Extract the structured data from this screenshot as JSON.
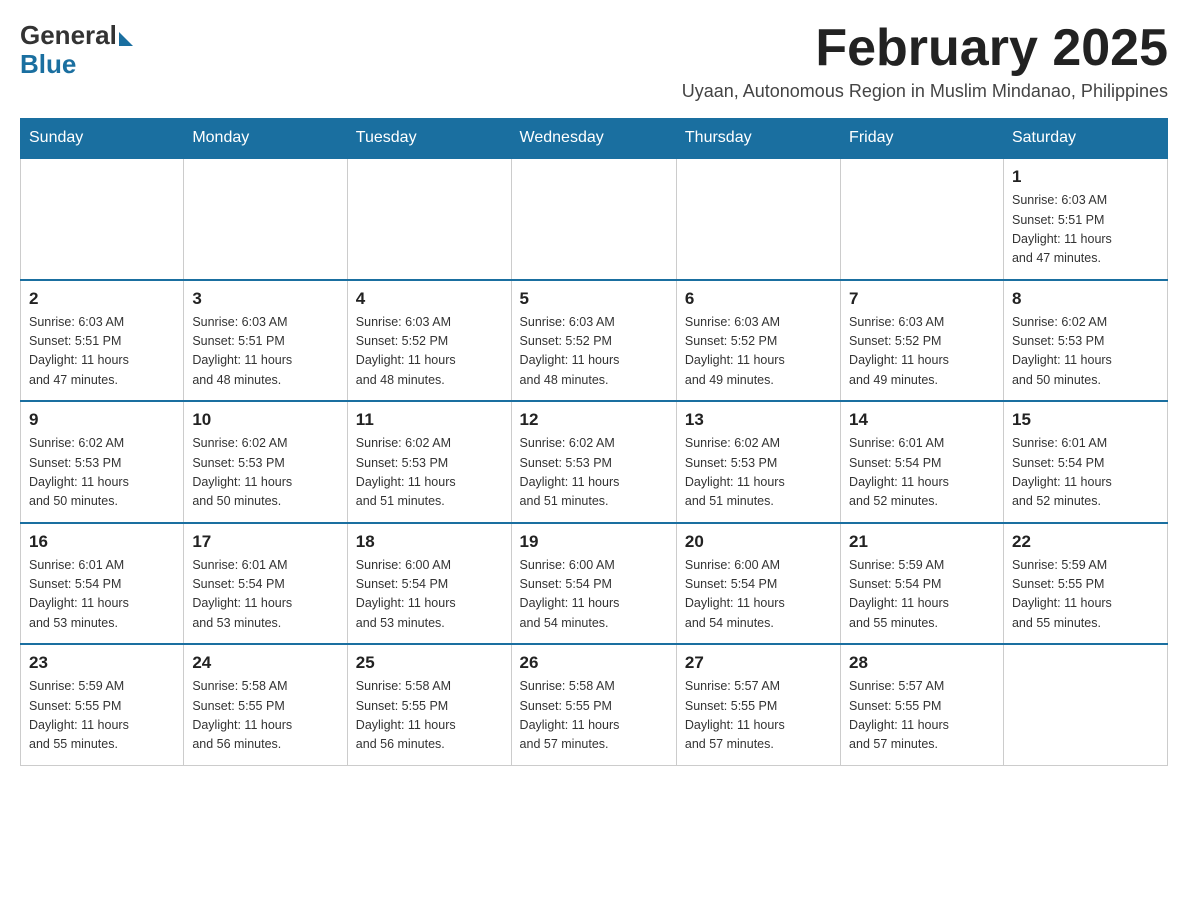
{
  "logo": {
    "general": "General",
    "blue": "Blue"
  },
  "title": "February 2025",
  "subtitle": "Uyaan, Autonomous Region in Muslim Mindanao, Philippines",
  "days_of_week": [
    "Sunday",
    "Monday",
    "Tuesday",
    "Wednesday",
    "Thursday",
    "Friday",
    "Saturday"
  ],
  "weeks": [
    [
      {
        "day": "",
        "info": ""
      },
      {
        "day": "",
        "info": ""
      },
      {
        "day": "",
        "info": ""
      },
      {
        "day": "",
        "info": ""
      },
      {
        "day": "",
        "info": ""
      },
      {
        "day": "",
        "info": ""
      },
      {
        "day": "1",
        "info": "Sunrise: 6:03 AM\nSunset: 5:51 PM\nDaylight: 11 hours\nand 47 minutes."
      }
    ],
    [
      {
        "day": "2",
        "info": "Sunrise: 6:03 AM\nSunset: 5:51 PM\nDaylight: 11 hours\nand 47 minutes."
      },
      {
        "day": "3",
        "info": "Sunrise: 6:03 AM\nSunset: 5:51 PM\nDaylight: 11 hours\nand 48 minutes."
      },
      {
        "day": "4",
        "info": "Sunrise: 6:03 AM\nSunset: 5:52 PM\nDaylight: 11 hours\nand 48 minutes."
      },
      {
        "day": "5",
        "info": "Sunrise: 6:03 AM\nSunset: 5:52 PM\nDaylight: 11 hours\nand 48 minutes."
      },
      {
        "day": "6",
        "info": "Sunrise: 6:03 AM\nSunset: 5:52 PM\nDaylight: 11 hours\nand 49 minutes."
      },
      {
        "day": "7",
        "info": "Sunrise: 6:03 AM\nSunset: 5:52 PM\nDaylight: 11 hours\nand 49 minutes."
      },
      {
        "day": "8",
        "info": "Sunrise: 6:02 AM\nSunset: 5:53 PM\nDaylight: 11 hours\nand 50 minutes."
      }
    ],
    [
      {
        "day": "9",
        "info": "Sunrise: 6:02 AM\nSunset: 5:53 PM\nDaylight: 11 hours\nand 50 minutes."
      },
      {
        "day": "10",
        "info": "Sunrise: 6:02 AM\nSunset: 5:53 PM\nDaylight: 11 hours\nand 50 minutes."
      },
      {
        "day": "11",
        "info": "Sunrise: 6:02 AM\nSunset: 5:53 PM\nDaylight: 11 hours\nand 51 minutes."
      },
      {
        "day": "12",
        "info": "Sunrise: 6:02 AM\nSunset: 5:53 PM\nDaylight: 11 hours\nand 51 minutes."
      },
      {
        "day": "13",
        "info": "Sunrise: 6:02 AM\nSunset: 5:53 PM\nDaylight: 11 hours\nand 51 minutes."
      },
      {
        "day": "14",
        "info": "Sunrise: 6:01 AM\nSunset: 5:54 PM\nDaylight: 11 hours\nand 52 minutes."
      },
      {
        "day": "15",
        "info": "Sunrise: 6:01 AM\nSunset: 5:54 PM\nDaylight: 11 hours\nand 52 minutes."
      }
    ],
    [
      {
        "day": "16",
        "info": "Sunrise: 6:01 AM\nSunset: 5:54 PM\nDaylight: 11 hours\nand 53 minutes."
      },
      {
        "day": "17",
        "info": "Sunrise: 6:01 AM\nSunset: 5:54 PM\nDaylight: 11 hours\nand 53 minutes."
      },
      {
        "day": "18",
        "info": "Sunrise: 6:00 AM\nSunset: 5:54 PM\nDaylight: 11 hours\nand 53 minutes."
      },
      {
        "day": "19",
        "info": "Sunrise: 6:00 AM\nSunset: 5:54 PM\nDaylight: 11 hours\nand 54 minutes."
      },
      {
        "day": "20",
        "info": "Sunrise: 6:00 AM\nSunset: 5:54 PM\nDaylight: 11 hours\nand 54 minutes."
      },
      {
        "day": "21",
        "info": "Sunrise: 5:59 AM\nSunset: 5:54 PM\nDaylight: 11 hours\nand 55 minutes."
      },
      {
        "day": "22",
        "info": "Sunrise: 5:59 AM\nSunset: 5:55 PM\nDaylight: 11 hours\nand 55 minutes."
      }
    ],
    [
      {
        "day": "23",
        "info": "Sunrise: 5:59 AM\nSunset: 5:55 PM\nDaylight: 11 hours\nand 55 minutes."
      },
      {
        "day": "24",
        "info": "Sunrise: 5:58 AM\nSunset: 5:55 PM\nDaylight: 11 hours\nand 56 minutes."
      },
      {
        "day": "25",
        "info": "Sunrise: 5:58 AM\nSunset: 5:55 PM\nDaylight: 11 hours\nand 56 minutes."
      },
      {
        "day": "26",
        "info": "Sunrise: 5:58 AM\nSunset: 5:55 PM\nDaylight: 11 hours\nand 57 minutes."
      },
      {
        "day": "27",
        "info": "Sunrise: 5:57 AM\nSunset: 5:55 PM\nDaylight: 11 hours\nand 57 minutes."
      },
      {
        "day": "28",
        "info": "Sunrise: 5:57 AM\nSunset: 5:55 PM\nDaylight: 11 hours\nand 57 minutes."
      },
      {
        "day": "",
        "info": ""
      }
    ]
  ]
}
